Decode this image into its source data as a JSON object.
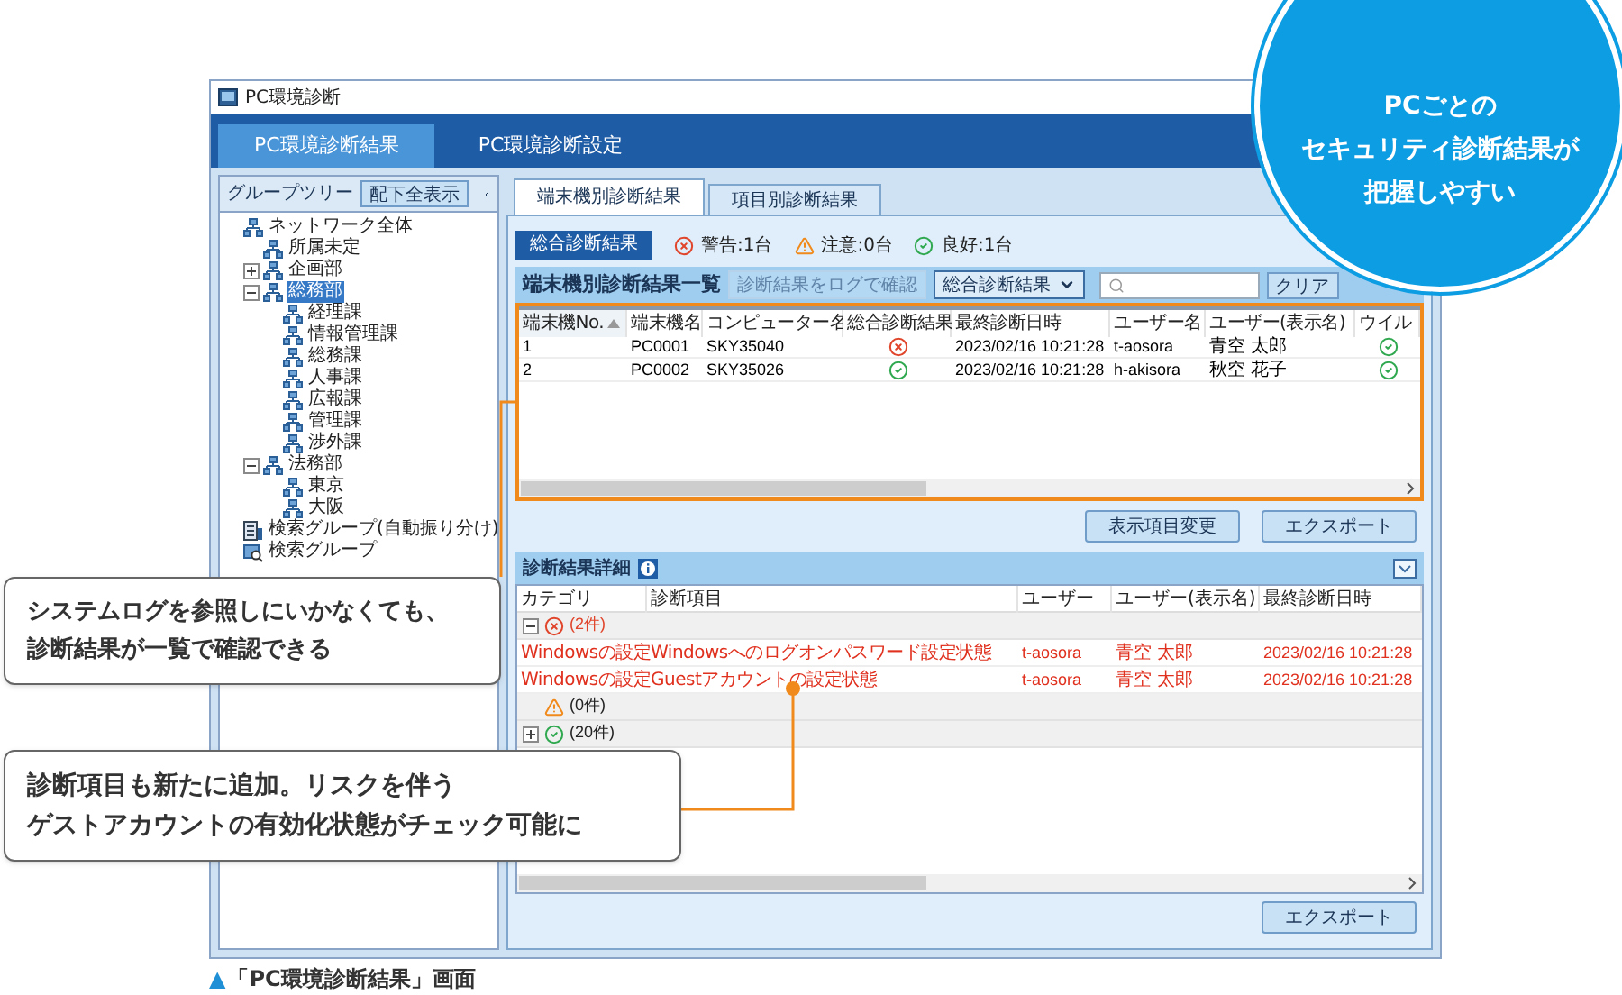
{
  "window": {
    "title": "PC環境診断"
  },
  "nav_tabs": [
    {
      "label": "PC環境診断結果",
      "selected": true
    },
    {
      "label": "PC環境診断設定",
      "selected": false
    }
  ],
  "group_tree": {
    "title": "グループツリー",
    "show_all_button": "配下全表示",
    "nodes": [
      {
        "label": "ネットワーク全体",
        "kind": "network",
        "selected": false,
        "children": [
          {
            "label": "所属未定",
            "kind": "network",
            "selected": false
          },
          {
            "label": "企画部",
            "kind": "network",
            "selected": false,
            "expanded": false
          },
          {
            "label": "総務部",
            "kind": "network",
            "selected": true,
            "expanded": true,
            "children": [
              {
                "label": "経理課",
                "kind": "network",
                "selected": false
              },
              {
                "label": "情報管理課",
                "kind": "network",
                "selected": false
              },
              {
                "label": "総務課",
                "kind": "network",
                "selected": false
              },
              {
                "label": "人事課",
                "kind": "network",
                "selected": false
              },
              {
                "label": "広報課",
                "kind": "network",
                "selected": false
              },
              {
                "label": "管理課",
                "kind": "network",
                "selected": false
              },
              {
                "label": "渉外課",
                "kind": "network",
                "selected": false
              }
            ]
          },
          {
            "label": "法務部",
            "kind": "network",
            "selected": false,
            "expanded": true,
            "children": [
              {
                "label": "東京",
                "kind": "network",
                "selected": false
              },
              {
                "label": "大阪",
                "kind": "network",
                "selected": false
              }
            ]
          }
        ]
      },
      {
        "label": "検索グループ(自動振り分け)",
        "kind": "auto_search",
        "selected": false
      },
      {
        "label": "検索グループ",
        "kind": "search",
        "selected": false
      }
    ]
  },
  "result_tabs": [
    {
      "label": "端末機別診断結果",
      "selected": true
    },
    {
      "label": "項目別診断結果",
      "selected": false
    }
  ],
  "summary": {
    "label": "総合診断結果",
    "items": [
      {
        "kind": "error",
        "text": "警告:1台"
      },
      {
        "kind": "warning",
        "text": "注意:0台"
      },
      {
        "kind": "ok",
        "text": "良好:1台"
      }
    ]
  },
  "device_list": {
    "title": "端末機別診断結果一覧",
    "log_button": {
      "label": "診断結果をログで確認",
      "disabled": true
    },
    "filter_dropdown": "総合診断結果",
    "clear_button": "クリア",
    "columns": [
      {
        "label": "端末機No.",
        "sorted": true
      },
      {
        "label": "端末機名",
        "sorted": false
      },
      {
        "label": "コンピューター名",
        "sorted": false
      },
      {
        "label": "総合診断結果",
        "sorted": false
      },
      {
        "label": "最終診断日時",
        "sorted": false
      },
      {
        "label": "ユーザー名",
        "sorted": false
      },
      {
        "label": "ユーザー(表示名)",
        "sorted": false
      },
      {
        "label": "ウイル",
        "sorted": false
      }
    ],
    "rows": [
      {
        "no": "1",
        "device": "PC0001",
        "computer": "SKY35040",
        "result": {
          "kind": "error"
        },
        "date": "2023/02/16 10:21:28",
        "user": "t-aosora",
        "display_name": "青空 太郎",
        "virus": {
          "kind": "ok"
        }
      },
      {
        "no": "2",
        "device": "PC0002",
        "computer": "SKY35026",
        "result": {
          "kind": "ok"
        },
        "date": "2023/02/16 10:21:28",
        "user": "h-akisora",
        "display_name": "秋空 花子",
        "virus": {
          "kind": "ok"
        }
      }
    ]
  },
  "list_buttons": [
    "表示項目変更",
    "エクスポート"
  ],
  "detail": {
    "title": "診断結果詳細",
    "columns": [
      "カテゴリ",
      "診断項目",
      "ユーザー",
      "ユーザー(表示名)",
      "最終診断日時"
    ],
    "groups": [
      {
        "kind": "error",
        "count": "(2件)",
        "expanded": true,
        "rows": [
          {
            "category": "Windowsの設定",
            "item": "Windowsへのログオンパスワード設定状態",
            "user": "t-aosora",
            "display_name": "青空 太郎",
            "date": "2023/02/16 10:21:28"
          },
          {
            "category": "Windowsの設定",
            "item": "Guestアカウントの設定状態",
            "user": "t-aosora",
            "display_name": "青空 太郎",
            "date": "2023/02/16 10:21:28"
          }
        ]
      },
      {
        "kind": "warning",
        "count": "(0件)"
      },
      {
        "kind": "ok",
        "count": "(20件)",
        "expanded": false
      }
    ],
    "export_button": "エクスポート"
  },
  "highlight": {
    "lines": [
      "PCごとの",
      "セキュリティ診断結果が",
      "把握しやすい"
    ]
  },
  "callouts": [
    {
      "lines": [
        "システムログを参照しにいかなくても、",
        "診断結果が一覧で確認できる"
      ]
    },
    {
      "lines": [
        "診断項目も新たに追加。リスクを伴う",
        "ゲストアカウントの有効化状態がチェック可能に"
      ]
    }
  ],
  "caption": {
    "marker": "▲",
    "text": "「PC環境診断結果」画面"
  }
}
